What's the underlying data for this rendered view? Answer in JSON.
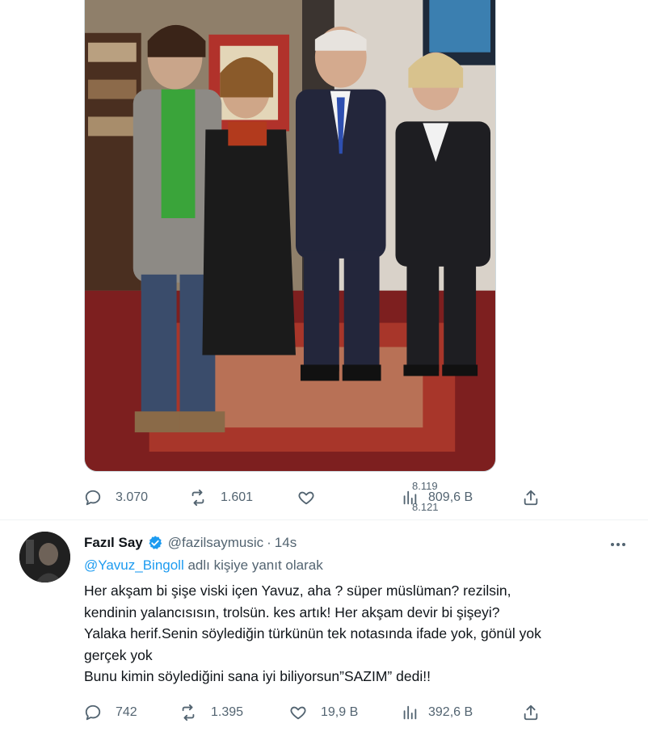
{
  "first_tweet": {
    "stats": {
      "replies": "3.070",
      "retweets": "1.601",
      "likes_prev": "8.119",
      "likes_next": "8.121",
      "views": "809,6 B"
    }
  },
  "reply_tweet": {
    "author": {
      "display_name": "Fazıl Say",
      "handle": "@fazilsaymusic",
      "separator": "·",
      "time": "14s"
    },
    "reply_to": {
      "mention": "@Yavuz_Bingoll",
      "suffix": " adlı kişiye yanıt olarak"
    },
    "body_lines": [
      "Her akşam bi şişe viski içen Yavuz, aha ? süper müslüman? rezilsin,",
      "kendinin yalancısısın, trolsün. kes artık! Her akşam devir bi şişeyi?",
      "Yalaka herif.Senin söylediğin türkünün tek notasında ifade yok, gönül yok",
      "gerçek yok",
      "Bunu kimin söylediğini sana iyi biliyorsun”SAZIM” dedi!!"
    ],
    "stats": {
      "replies": "742",
      "retweets": "1.395",
      "likes": "19,9 B",
      "views": "392,6 B"
    }
  },
  "colors": {
    "text_primary": "#0f1419",
    "text_secondary": "#536471",
    "link": "#1d9bf0",
    "verified": "#1d9bf0",
    "divider": "#eff3f4"
  },
  "icons": [
    "reply-icon",
    "retweet-icon",
    "like-icon",
    "views-icon",
    "share-icon",
    "verified-badge-icon",
    "more-icon"
  ]
}
